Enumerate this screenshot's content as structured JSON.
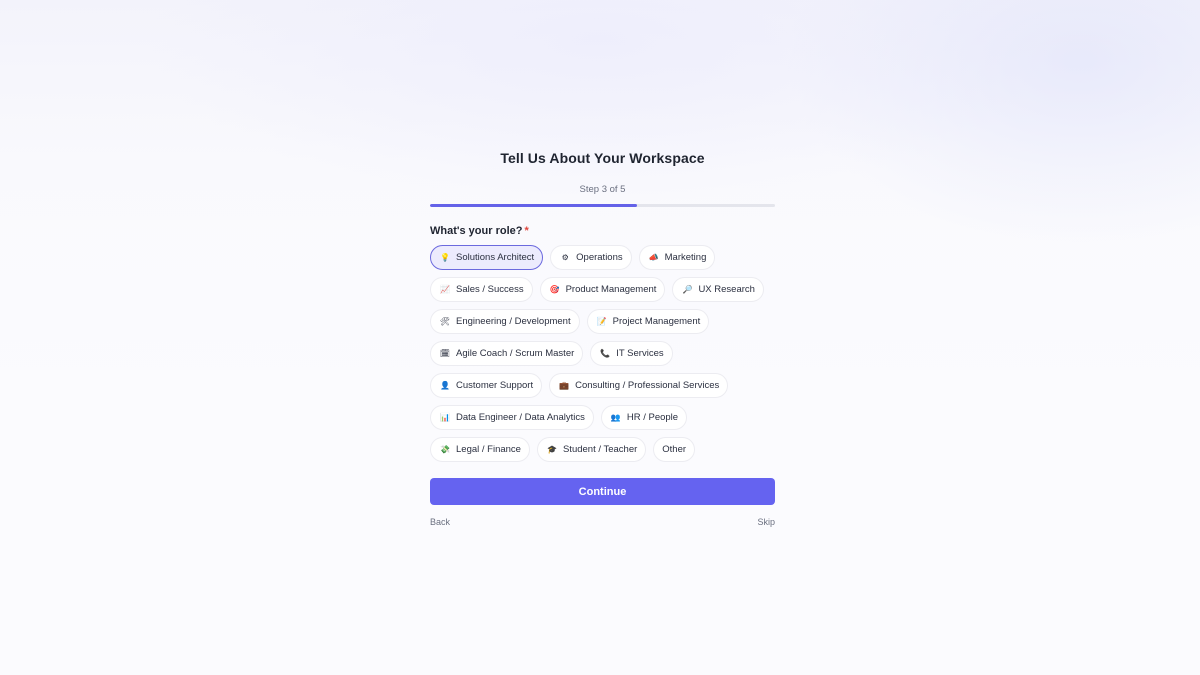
{
  "title": "Tell Us About Your Workspace",
  "step": {
    "label": "Step 3 of 5",
    "current": 3,
    "total": 5,
    "progress": 0.6
  },
  "question": {
    "label": "What's your role?",
    "required_mark": "*"
  },
  "roles": [
    [
      {
        "label": "Solutions Architect",
        "icon": "lightbulb-icon",
        "glyph": "💡",
        "selected": true
      },
      {
        "label": "Operations",
        "icon": "gear-icon",
        "glyph": "⚙"
      },
      {
        "label": "Marketing",
        "icon": "megaphone-icon",
        "glyph": "📣"
      }
    ],
    [
      {
        "label": "Sales / Success",
        "icon": "chart-icon",
        "glyph": "📈"
      },
      {
        "label": "Product Management",
        "icon": "target-icon",
        "glyph": "🎯"
      },
      {
        "label": "UX Research",
        "icon": "magnifier-icon",
        "glyph": "🔎"
      }
    ],
    [
      {
        "label": "Engineering / Development",
        "icon": "tools-icon",
        "glyph": "🛠"
      },
      {
        "label": "Project Management",
        "icon": "memo-icon",
        "glyph": "📝"
      }
    ],
    [
      {
        "label": "Agile Coach / Scrum Master",
        "icon": "calendar-icon",
        "glyph": "🗓"
      },
      {
        "label": "IT Services",
        "icon": "phone-icon",
        "glyph": "📞"
      }
    ],
    [
      {
        "label": "Customer Support",
        "icon": "person-icon",
        "glyph": "👤"
      },
      {
        "label": "Consulting / Professional Services",
        "icon": "briefcase-icon",
        "glyph": "💼"
      }
    ],
    [
      {
        "label": "Data Engineer / Data Analytics",
        "icon": "bar-chart-icon",
        "glyph": "📊"
      },
      {
        "label": "HR / People",
        "icon": "people-icon",
        "glyph": "👥"
      }
    ],
    [
      {
        "label": "Legal / Finance",
        "icon": "money-icon",
        "glyph": "💸"
      },
      {
        "label": "Student / Teacher",
        "icon": "graduation-cap-icon",
        "glyph": "🎓"
      },
      {
        "label": "Other",
        "icon": "",
        "glyph": ""
      }
    ]
  ],
  "buttons": {
    "continue": "Continue",
    "back": "Back",
    "skip": "Skip"
  },
  "colors": {
    "accent": "#6563f0",
    "selected_bg": "#ecebfd",
    "required": "#e0443a"
  }
}
